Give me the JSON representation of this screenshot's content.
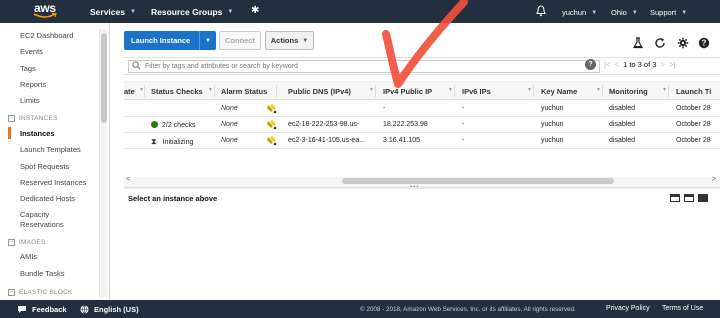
{
  "topnav": {
    "logo": "aws",
    "services": "Services",
    "resource_groups": "Resource Groups",
    "user": "yuchun",
    "region": "Ohio",
    "support": "Support"
  },
  "sidebar": {
    "items": [
      {
        "label": "EC2 Dashboard"
      },
      {
        "label": "Events"
      },
      {
        "label": "Tags"
      },
      {
        "label": "Reports"
      },
      {
        "label": "Limits"
      }
    ],
    "section_instances": "INSTANCES",
    "instances_items": [
      {
        "label": "Instances",
        "active": true
      },
      {
        "label": "Launch Templates"
      },
      {
        "label": "Spot Requests"
      },
      {
        "label": "Reserved Instances"
      },
      {
        "label": "Dedicated Hosts"
      },
      {
        "label": "Capacity"
      },
      {
        "label": "Reservations"
      }
    ],
    "section_images": "IMAGES",
    "images_items": [
      {
        "label": "AMIs"
      },
      {
        "label": "Bundle Tasks"
      }
    ],
    "section_ebs": "ELASTIC BLOCK"
  },
  "toolbar": {
    "launch_label": "Launch Instance",
    "connect_label": "Connect",
    "actions_label": "Actions"
  },
  "filter": {
    "placeholder": "Filter by tags and attributes or search by keyword"
  },
  "pager": {
    "text": "1 to 3 of 3"
  },
  "table": {
    "headers": [
      "ate",
      "Status Checks",
      "Alarm Status",
      "Public DNS (IPv4)",
      "IPv4 Public IP",
      "IPv6 IPs",
      "Key Name",
      "Monitoring",
      "Launch Ti"
    ],
    "rows": [
      {
        "status": "",
        "alarm": "None",
        "dns": "",
        "ip": "-",
        "ipv6": "-",
        "key": "yuchun",
        "monitoring": "disabled",
        "launch": "October 28"
      },
      {
        "status": "2/2 checks",
        "alarm": "None",
        "dns": "ec2-18-222-253-98.us-",
        "ip": "18.222.253.98",
        "ipv6": "-",
        "key": "yuchun",
        "monitoring": "disabled",
        "launch": "October 28"
      },
      {
        "status": "Initializing",
        "alarm": "None",
        "dns": "ec2-3-16-41-105.us-ea...",
        "ip": "3.16.41.105",
        "ipv6": "-",
        "key": "yuchun",
        "monitoring": "disabled",
        "launch": "October 28"
      }
    ]
  },
  "detail": {
    "title": "Select an instance above"
  },
  "footer": {
    "feedback": "Feedback",
    "language": "English (US)",
    "copyright": "© 2008 - 2018, Amazon Web Services, Inc. or its affiliates. All rights reserved.",
    "privacy": "Privacy Policy",
    "terms": "Terms of Use"
  },
  "colors": {
    "nav_bg": "#232f3e",
    "launch_blue": "#1a73c8",
    "active_orange": "#e47911",
    "status_green": "#1d8102",
    "annotation_red": "#f0503c"
  },
  "icons": [
    "bell-icon",
    "pin-icon",
    "flask-icon",
    "refresh-icon",
    "gear-icon",
    "help-icon",
    "search-icon",
    "alarm-bell-icon",
    "hourglass-icon",
    "speech-bubble-icon",
    "globe-icon"
  ]
}
